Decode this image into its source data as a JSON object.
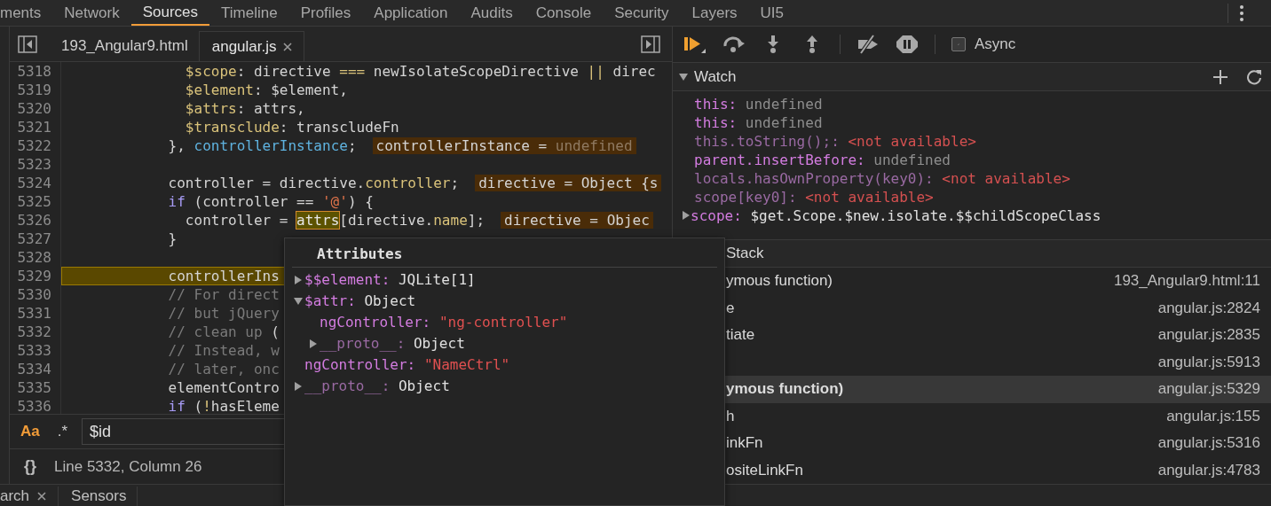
{
  "top_tabs": [
    {
      "label": "ments",
      "selected": false
    },
    {
      "label": "Network",
      "selected": false
    },
    {
      "label": "Sources",
      "selected": true
    },
    {
      "label": "Timeline",
      "selected": false
    },
    {
      "label": "Profiles",
      "selected": false
    },
    {
      "label": "Application",
      "selected": false
    },
    {
      "label": "Audits",
      "selected": false
    },
    {
      "label": "Console",
      "selected": false
    },
    {
      "label": "Security",
      "selected": false
    },
    {
      "label": "Layers",
      "selected": false
    },
    {
      "label": "UI5",
      "selected": false
    }
  ],
  "editor": {
    "file_tabs": [
      {
        "label": "193_Angular9.html",
        "selected": false,
        "closable": false
      },
      {
        "label": "angular.js",
        "selected": true,
        "closable": true
      }
    ],
    "lines": [
      {
        "number": "5318",
        "current": false,
        "tokens": [
          {
            "kind": "p",
            "text": "              $scope"
          },
          {
            "kind": "t",
            "text": ": directive "
          },
          {
            "kind": "o",
            "text": "==="
          },
          {
            "kind": "t",
            "text": " newIsolateScopeDirective "
          },
          {
            "kind": "o",
            "text": "||"
          },
          {
            "kind": "t",
            "text": " direc"
          }
        ]
      },
      {
        "number": "5319",
        "current": false,
        "tokens": [
          {
            "kind": "p",
            "text": "              $element"
          },
          {
            "kind": "t",
            "text": ": $element,"
          }
        ]
      },
      {
        "number": "5320",
        "current": false,
        "tokens": [
          {
            "kind": "p",
            "text": "              $attrs"
          },
          {
            "kind": "t",
            "text": ": attrs,"
          }
        ]
      },
      {
        "number": "5321",
        "current": false,
        "tokens": [
          {
            "kind": "p",
            "text": "              $transclude"
          },
          {
            "kind": "t",
            "text": ": transcludeFn"
          }
        ]
      },
      {
        "number": "5322",
        "current": false,
        "tokens": [
          {
            "kind": "t",
            "text": "            }, "
          },
          {
            "kind": "v",
            "text": "controllerInstance"
          },
          {
            "kind": "t",
            "text": ";"
          }
        ],
        "inline": [
          {
            "kind": "t",
            "text": "controllerInstance = "
          },
          {
            "kind": "d",
            "text": "undefined"
          }
        ]
      },
      {
        "number": "5323",
        "current": false
      },
      {
        "number": "5324",
        "current": false,
        "tokens": [
          {
            "kind": "t",
            "text": "            controller = directive."
          },
          {
            "kind": "p",
            "text": "controller"
          },
          {
            "kind": "t",
            "text": ";"
          }
        ],
        "inline": [
          {
            "kind": "t",
            "text": "directive = Object {s"
          }
        ]
      },
      {
        "number": "5325",
        "current": false,
        "tokens": [
          {
            "kind": "k",
            "text": "            if"
          },
          {
            "kind": "t",
            "text": " (controller == "
          },
          {
            "kind": "s",
            "text": "'@'"
          },
          {
            "kind": "t",
            "text": ") {"
          }
        ]
      },
      {
        "number": "5326",
        "current": false,
        "tokens": [
          {
            "kind": "t",
            "text": "              controller = "
          },
          {
            "kind": "h",
            "text": "attrs"
          },
          {
            "kind": "t",
            "text": "[directive."
          },
          {
            "kind": "p",
            "text": "name"
          },
          {
            "kind": "t",
            "text": "];"
          }
        ],
        "inline": [
          {
            "kind": "t",
            "text": "directive = Objec"
          }
        ]
      },
      {
        "number": "5327",
        "current": false,
        "tokens": [
          {
            "kind": "t",
            "text": "            }"
          }
        ]
      },
      {
        "number": "5328",
        "current": false
      },
      {
        "number": "5329",
        "current": true,
        "tokens": [
          {
            "kind": "t",
            "text": "            controllerIns"
          }
        ]
      },
      {
        "number": "5330",
        "current": false,
        "tokens": [
          {
            "kind": "c",
            "text": "            // For direct"
          }
        ]
      },
      {
        "number": "5331",
        "current": false,
        "tokens": [
          {
            "kind": "c",
            "text": "            // but jQuery"
          }
        ]
      },
      {
        "number": "5332",
        "current": false,
        "tokens": [
          {
            "kind": "c",
            "text": "            // clean up "
          },
          {
            "kind": "t",
            "text": "("
          }
        ]
      },
      {
        "number": "5333",
        "current": false,
        "tokens": [
          {
            "kind": "c",
            "text": "            // Instead, w"
          }
        ]
      },
      {
        "number": "5334",
        "current": false,
        "tokens": [
          {
            "kind": "c",
            "text": "            // later, onc"
          }
        ]
      },
      {
        "number": "5335",
        "current": false,
        "tokens": [
          {
            "kind": "t",
            "text": "            elementContro"
          }
        ]
      },
      {
        "number": "5336",
        "current": false,
        "tokens": [
          {
            "kind": "k",
            "text": "            if"
          },
          {
            "kind": "t",
            "text": " ("
          },
          {
            "kind": "o",
            "text": "!"
          },
          {
            "kind": "t",
            "text": "hasEleme"
          }
        ]
      }
    ],
    "search": {
      "case_label": "Aa",
      "case_sensitive": true,
      "regex_label": ".*",
      "regex": false,
      "value": "$id"
    },
    "status": {
      "format_label": "{}",
      "position": "Line 5332, Column 26"
    }
  },
  "debugger": {
    "async": {
      "label": "Async",
      "checked": true
    },
    "watch": {
      "title": "Watch",
      "expanded": true,
      "items": [
        {
          "name": "this:",
          "value": "undefined",
          "kind": "undefined"
        },
        {
          "name": "this:",
          "value": "undefined",
          "kind": "undefined"
        },
        {
          "name": "this.toString();:",
          "value": "<not available>",
          "kind": "error"
        },
        {
          "name": "parent.insertBefore:",
          "value": "undefined",
          "kind": "undefined"
        },
        {
          "name": "locals.hasOwnProperty(key0):",
          "value": "<not available>",
          "kind": "error"
        },
        {
          "name": "scope[key0]:",
          "value": "<not available>",
          "kind": "error"
        },
        {
          "name": "scope:",
          "value": "$get.Scope.$new.isolate.$$childScopeClass",
          "kind": "object",
          "expanded": false
        }
      ]
    },
    "call_stack": {
      "title": "Stack",
      "frames": [
        {
          "function": "ymous function)",
          "location": "193_Angular9.html:11",
          "selected": false
        },
        {
          "function": "e",
          "location": "angular.js:2824",
          "selected": false
        },
        {
          "function": "tiate",
          "location": "angular.js:2835",
          "selected": false
        },
        {
          "location": "angular.js:5913",
          "selected": false
        },
        {
          "function": "ymous function)",
          "location": "angular.js:5329",
          "selected": true
        },
        {
          "function": "h",
          "location": "angular.js:155",
          "selected": false
        },
        {
          "function": "inkFn",
          "location": "angular.js:5316",
          "selected": false
        },
        {
          "function": "ositeLinkFn",
          "location": "angular.js:4783",
          "selected": false
        }
      ]
    }
  },
  "popover": {
    "title": "Attributes",
    "items": [
      {
        "name": "$$element:",
        "value": "JQLite[1]",
        "kind": "object",
        "enumerable": true,
        "expanded": false
      },
      {
        "name": "$attr:",
        "value": "Object",
        "kind": "object",
        "enumerable": true,
        "expanded": true,
        "children": [
          {
            "name": "ngController:",
            "value": "\"ng-controller\"",
            "kind": "string",
            "enumerable": true
          },
          {
            "name": "__proto__:",
            "value": "Object",
            "kind": "object",
            "enumerable": false,
            "expanded": false
          }
        ]
      },
      {
        "name": "ngController:",
        "value": "\"NameCtrl\"",
        "kind": "string",
        "enumerable": true
      },
      {
        "name": "__proto__:",
        "value": "Object",
        "kind": "object",
        "enumerable": false,
        "expanded": false
      }
    ]
  },
  "drawer_tabs": [
    {
      "label": "arch",
      "closable": true
    },
    {
      "label": "Sensors",
      "closable": false
    }
  ]
}
